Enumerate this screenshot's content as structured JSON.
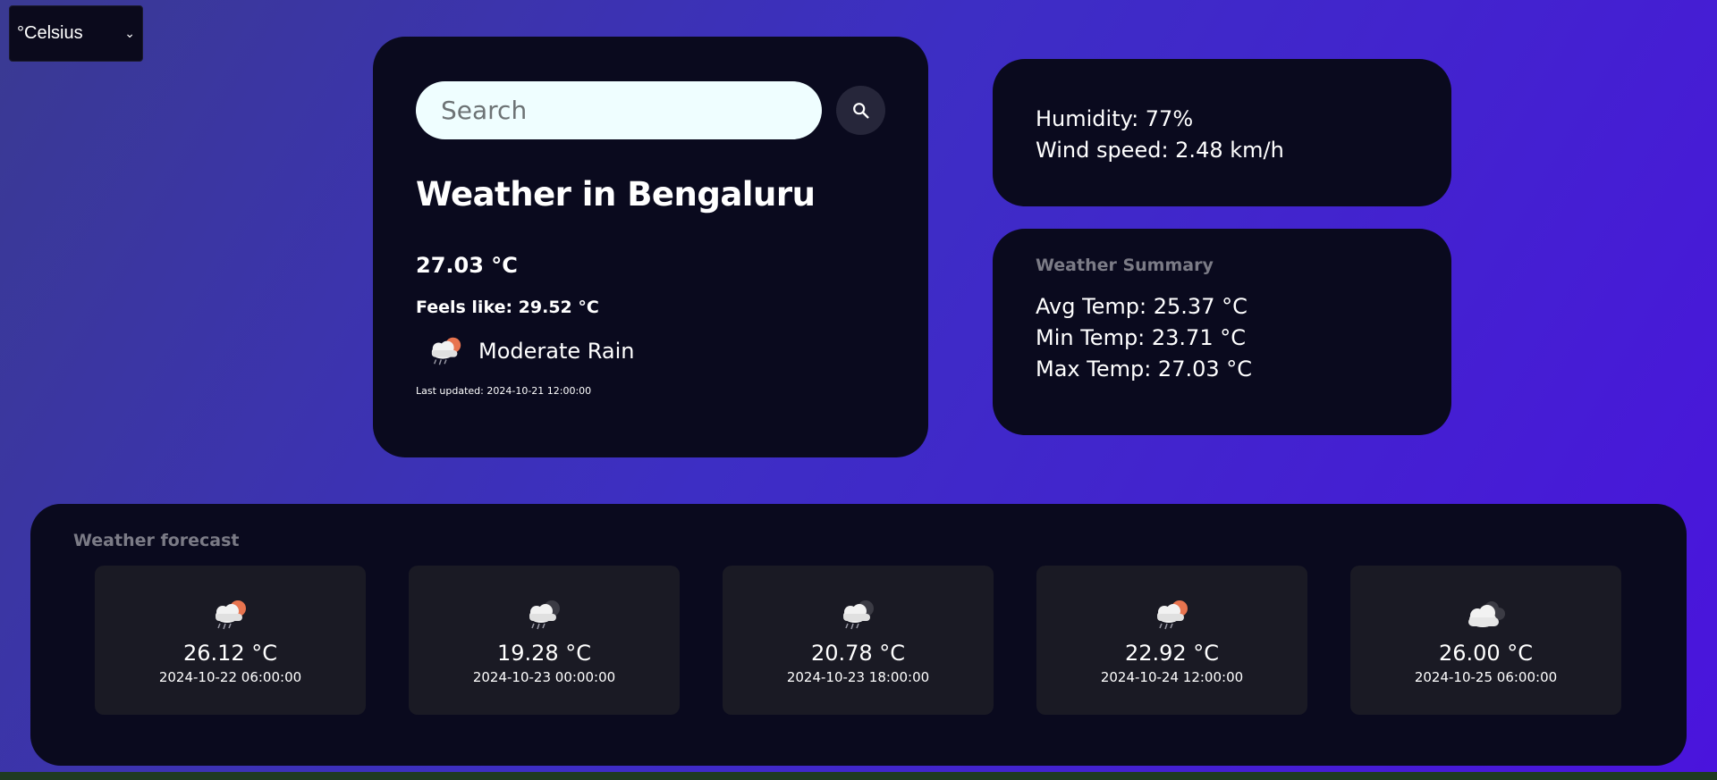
{
  "unit_select": {
    "value": "°Celsius"
  },
  "search": {
    "placeholder": "Search"
  },
  "current": {
    "city_title": "Weather in Bengaluru",
    "temp": "27.03 °C",
    "feels_like": "Feels like: 29.52 °C",
    "description": "Moderate Rain",
    "icon": "rain-cloud-sun-icon",
    "last_updated": "Last updated: 2024-10-21 12:00:00"
  },
  "details": {
    "humidity": "Humidity: 77%",
    "wind_speed": "Wind speed: 2.48 km/h"
  },
  "summary": {
    "title": "Weather Summary",
    "avg": "Avg Temp: 25.37 °C",
    "min": "Min Temp: 23.71 °C",
    "max": "Max Temp: 27.03 °C"
  },
  "forecast": {
    "title": "Weather forecast",
    "items": [
      {
        "temp": "26.12 °C",
        "date": "2024-10-22 06:00:00",
        "icon": "rain-cloud-sun-icon"
      },
      {
        "temp": "19.28 °C",
        "date": "2024-10-23 00:00:00",
        "icon": "rain-cloud-moon-icon"
      },
      {
        "temp": "20.78 °C",
        "date": "2024-10-23 18:00:00",
        "icon": "rain-cloud-moon-icon"
      },
      {
        "temp": "22.92 °C",
        "date": "2024-10-24 12:00:00",
        "icon": "rain-cloud-sun-icon"
      },
      {
        "temp": "26.00 °C",
        "date": "2024-10-25 06:00:00",
        "icon": "clouds-icon"
      }
    ]
  },
  "colors": {
    "card_bg": "#0a0a1e",
    "accent_sun": "#e8744f",
    "search_bg": "#effeff"
  }
}
